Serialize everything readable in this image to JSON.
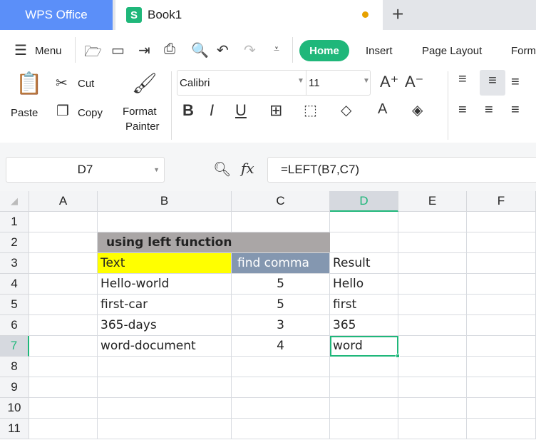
{
  "tabs": {
    "app": "WPS Office",
    "doc": "Book1",
    "new_tab": "+"
  },
  "toolbar": {
    "menu": "Menu",
    "tabs": [
      "Home",
      "Insert",
      "Page Layout",
      "Form"
    ]
  },
  "ribbon": {
    "paste": "Paste",
    "cut": "Cut",
    "copy": "Copy",
    "format_painter_1": "Format",
    "format_painter_2": "Painter",
    "font": "Calibri",
    "size": "11"
  },
  "formula_bar": {
    "name_box": "D7",
    "fx": "fx",
    "formula": "=LEFT(B7,C7)"
  },
  "columns": [
    "A",
    "B",
    "C",
    "D",
    "E",
    "F"
  ],
  "rows": [
    "1",
    "2",
    "3",
    "4",
    "5",
    "6",
    "7",
    "8",
    "9",
    "10",
    "11"
  ],
  "cells": {
    "B2": "using left function",
    "B3": "Text",
    "C3": "find comma",
    "D3": "Result",
    "B4": "Hello-world",
    "C4": "5",
    "D4": "Hello",
    "B5": "first-car",
    "C5": "5",
    "D5": "first",
    "B6": "365-days",
    "C6": "3",
    "D6": "365",
    "B7": "word-document",
    "C7": "4",
    "D7": "word"
  },
  "colors": {
    "accent": "#1fb77a",
    "header_fill": "#aaa6a6",
    "yellow": "#ffff00",
    "slate": "#8497b0"
  }
}
